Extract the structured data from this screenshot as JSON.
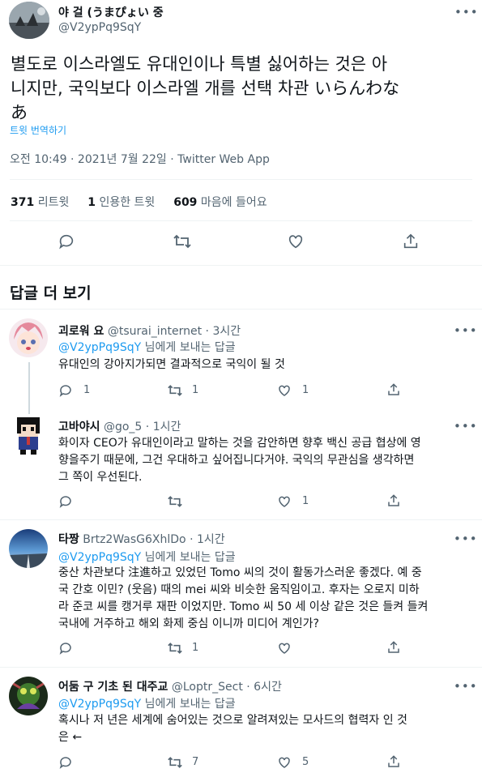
{
  "main_tweet": {
    "author_name": "야 걸 (うまぴょい 중",
    "handle": "@V2ypPq9SqY",
    "text": "별도로 이스라엘도 유대인이나 특별 싫어하는 것은 아니지만, 국익보다 이스라엘 개를 선택 차관 いらんわなぁ",
    "text_line1": "별도로 이스라엘도 유대인이나 특별 싫어하는 것은 아",
    "text_line2": "니지만, 국익보다 이스라엘 개를 선택 차관 いらんわな",
    "text_line3": "あ",
    "translate_label": "트윗 번역하기",
    "timestamp": "오전 10:49 · 2021년 7월 22일 · Twitter Web App",
    "stats": {
      "retweets_count": "371",
      "retweets_label": "리트윗",
      "quotes_count": "1",
      "quotes_label": "인용한 트윗",
      "likes_count": "609",
      "likes_label": "마음에 들어요"
    }
  },
  "replies_header": "답글 더 보기",
  "replies": [
    {
      "name": "괴로워 요",
      "handle": "@tsurai_internet",
      "time": "· 3시간",
      "replying_to": "@V2ypPq9SqY",
      "replying_suffix": "님에게 보내는 답글",
      "text": "유대인의 강아지가되면 결과적으로 국익이 될 것",
      "reply_count": "1",
      "retweet_count": "1",
      "like_count": "1"
    },
    {
      "name": "고바야시",
      "handle": "@go_5",
      "time": "· 1시간",
      "text_line1": "화이자 CEO가 유대인이라고 말하는 것을 감안하면 향후 백신 공급 협상에 영",
      "text_line2": "향을주기 때문에, 그건 우대하고 싶어집니다거야. 국익의 무관심을 생각하면",
      "text_line3": "그 쪽이 우선된다.",
      "reply_count": "",
      "retweet_count": "",
      "like_count": "1"
    },
    {
      "name": "타짱",
      "handle": "Brtz2WasG6XhlDo",
      "time": "· 1시간",
      "replying_to": "@V2ypPq9SqY",
      "replying_suffix": "님에게 보내는 답글",
      "text_line1": "중산 차관보다 注進하고 있었던 Tomo 씨의 것이 활동가스러운 좋겠다. 예 중",
      "text_line2": "국 간호 이민? (웃음) 때의 mei 씨와 비슷한 움직임이고. 후자는 오로지 미하",
      "text_line3": "라 준코 씨를 캥거루 재판 이었지만. Tomo 씨 50 세 이상 같은 것은 들켜 들켜",
      "text_line4": "국내에 거주하고 해외 화제 중심 이니까 미디어 계인가?",
      "reply_count": "",
      "retweet_count": "1",
      "like_count": ""
    },
    {
      "name": "어둠 구 기초 된 대주교",
      "handle": "@Loptr_Sect",
      "time": "· 6시간",
      "replying_to": "@V2ypPq9SqY",
      "replying_suffix": "님에게 보내는 답글",
      "text_line1": "혹시나 저 년은 세계에 숨어있는 것으로 알려져있는 모사드의 협력자 인 것",
      "text_line2": "은 ←",
      "reply_count": "",
      "retweet_count": "7",
      "like_count": "5"
    }
  ],
  "colors": {
    "accent": "#1d9bf0",
    "muted": "#536471",
    "divider": "#eff3f4"
  },
  "icons": [
    "reply-icon",
    "retweet-icon",
    "like-icon",
    "share-icon",
    "more-icon"
  ]
}
